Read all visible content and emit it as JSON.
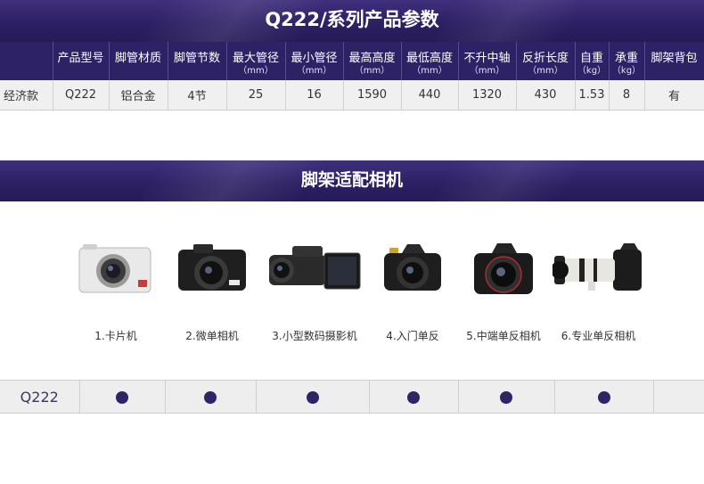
{
  "spec_section": {
    "title": "Q222/系列产品参数",
    "headers": [
      {
        "label": "",
        "unit": ""
      },
      {
        "label": "产品型号",
        "unit": ""
      },
      {
        "label": "脚管材质",
        "unit": ""
      },
      {
        "label": "脚管节数",
        "unit": ""
      },
      {
        "label": "最大管径",
        "unit": "（mm）"
      },
      {
        "label": "最小管径",
        "unit": "（mm）"
      },
      {
        "label": "最高高度",
        "unit": "（mm）"
      },
      {
        "label": "最低高度",
        "unit": "（mm）"
      },
      {
        "label": "不升中轴",
        "unit": "（mm）"
      },
      {
        "label": "反折长度",
        "unit": "（mm）"
      },
      {
        "label": "自重",
        "unit": "（kg）"
      },
      {
        "label": "承重",
        "unit": "（kg）"
      },
      {
        "label": "脚架背包",
        "unit": ""
      }
    ],
    "row": [
      "经济款",
      "Q222",
      "铝合金",
      "4节",
      "25",
      "16",
      "1590",
      "440",
      "1320",
      "430",
      "1.53",
      "8",
      "有"
    ]
  },
  "camera_section": {
    "title": "脚架适配相机",
    "cameras": [
      {
        "label": "1.卡片机",
        "icon": "compact-camera-icon"
      },
      {
        "label": "2.微单相机",
        "icon": "mirrorless-camera-icon"
      },
      {
        "label": "3.小型数码摄影机",
        "icon": "camcorder-icon"
      },
      {
        "label": "4.入门单反",
        "icon": "entry-dslr-icon"
      },
      {
        "label": "5.中端单反相机",
        "icon": "midrange-dslr-icon"
      },
      {
        "label": "6.专业单反相机",
        "icon": "pro-dslr-telephoto-icon"
      }
    ]
  },
  "compatibility": {
    "model": "Q222",
    "supported": [
      true,
      true,
      true,
      true,
      true,
      true
    ]
  },
  "colors": {
    "banner": "#2e2266",
    "dot": "#2f2466",
    "row_bg": "#f0f0f0"
  }
}
